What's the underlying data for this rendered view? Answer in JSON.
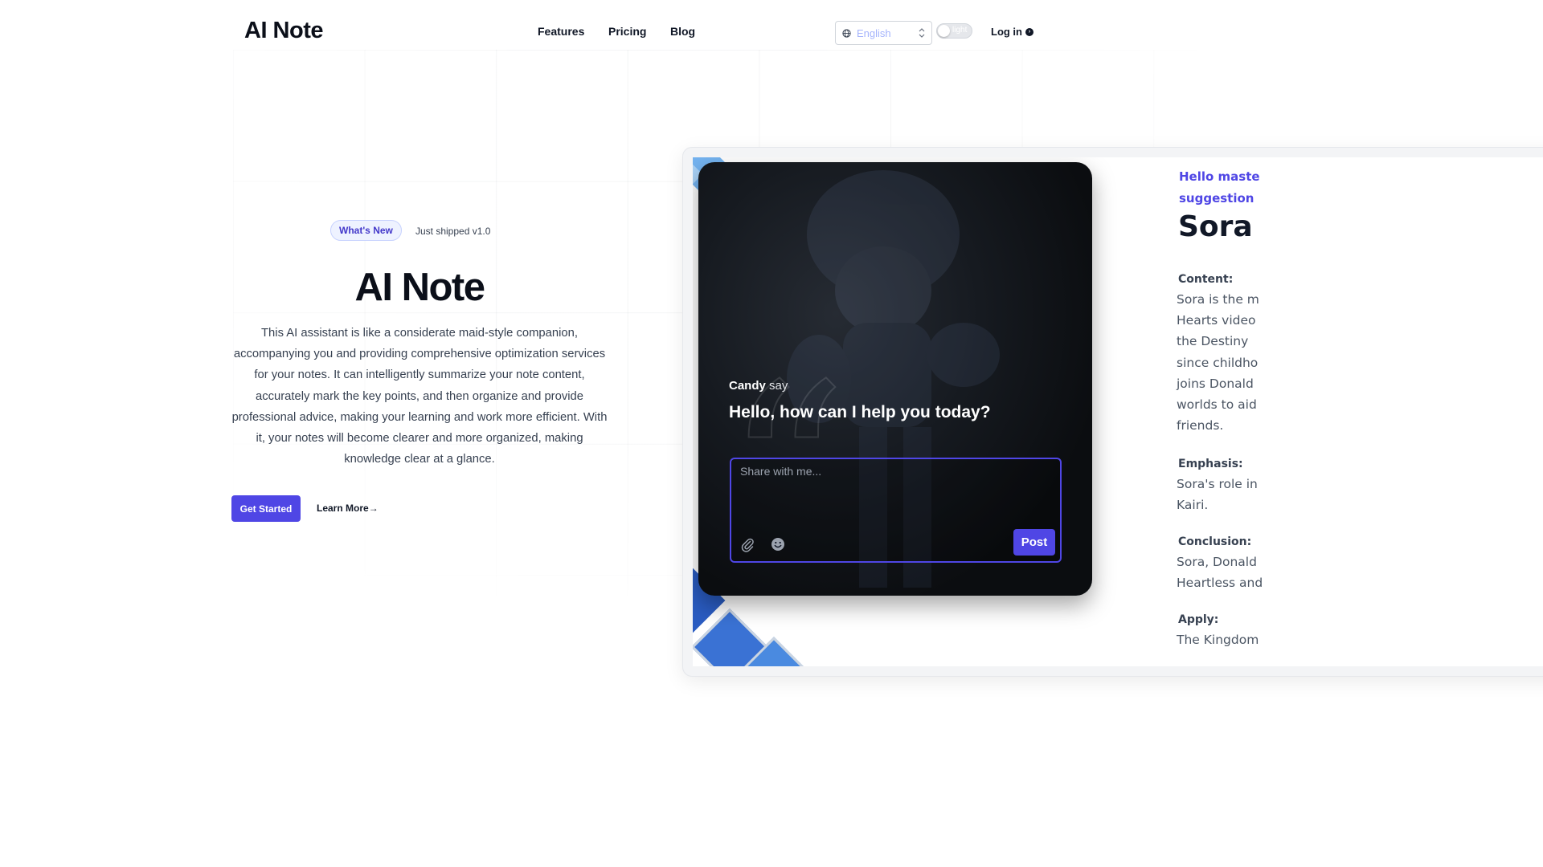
{
  "header": {
    "logo": "AI Note",
    "nav": [
      "Features",
      "Pricing",
      "Blog"
    ],
    "language": "English",
    "theme_toggle": "light",
    "login": "Log in"
  },
  "hero": {
    "badge": "What's New",
    "shipped": "Just shipped v1.0",
    "title": "AI Note",
    "description": "This AI assistant is like a considerate maid-style companion, accompanying you and providing comprehensive optimization services for your notes. It can intelligently summarize your note content, accurately mark the key points, and then organize and provide professional advice, making your learning and work more efficient. With it, your notes will become clearer and more organized, making knowledge clear at a glance.",
    "primary_button": "Get Started",
    "secondary_button": "Learn More",
    "secondary_arrow": "→"
  },
  "chat": {
    "speaker_name": "Candy",
    "speaker_suffix": "say",
    "greeting": "Hello, how can I help you today?",
    "input_placeholder": "Share with me...",
    "post_button": "Post"
  },
  "notes": {
    "intro_line1": "Hello maste",
    "intro_line2": "suggestion",
    "title": "Sora",
    "content_heading": "Content:",
    "content_lines": [
      "Sora is the m",
      "Hearts video",
      "the Destiny",
      "since childho",
      "joins Donald",
      "worlds to aid",
      "friends."
    ],
    "emphasis_heading": "Emphasis:",
    "emphasis_lines": [
      "Sora's role in",
      "Kairi."
    ],
    "conclusion_heading": "Conclusion:",
    "conclusion_lines": [
      "Sora, Donald",
      "Heartless and"
    ],
    "apply_heading": "Apply:",
    "apply_lines": [
      "The Kingdom"
    ]
  },
  "colors": {
    "accent": "#4f46e5",
    "diamond_light": "#74b3f0",
    "diamond_mid": "#3a72d4",
    "diamond_dark": "#2a5cc2"
  }
}
